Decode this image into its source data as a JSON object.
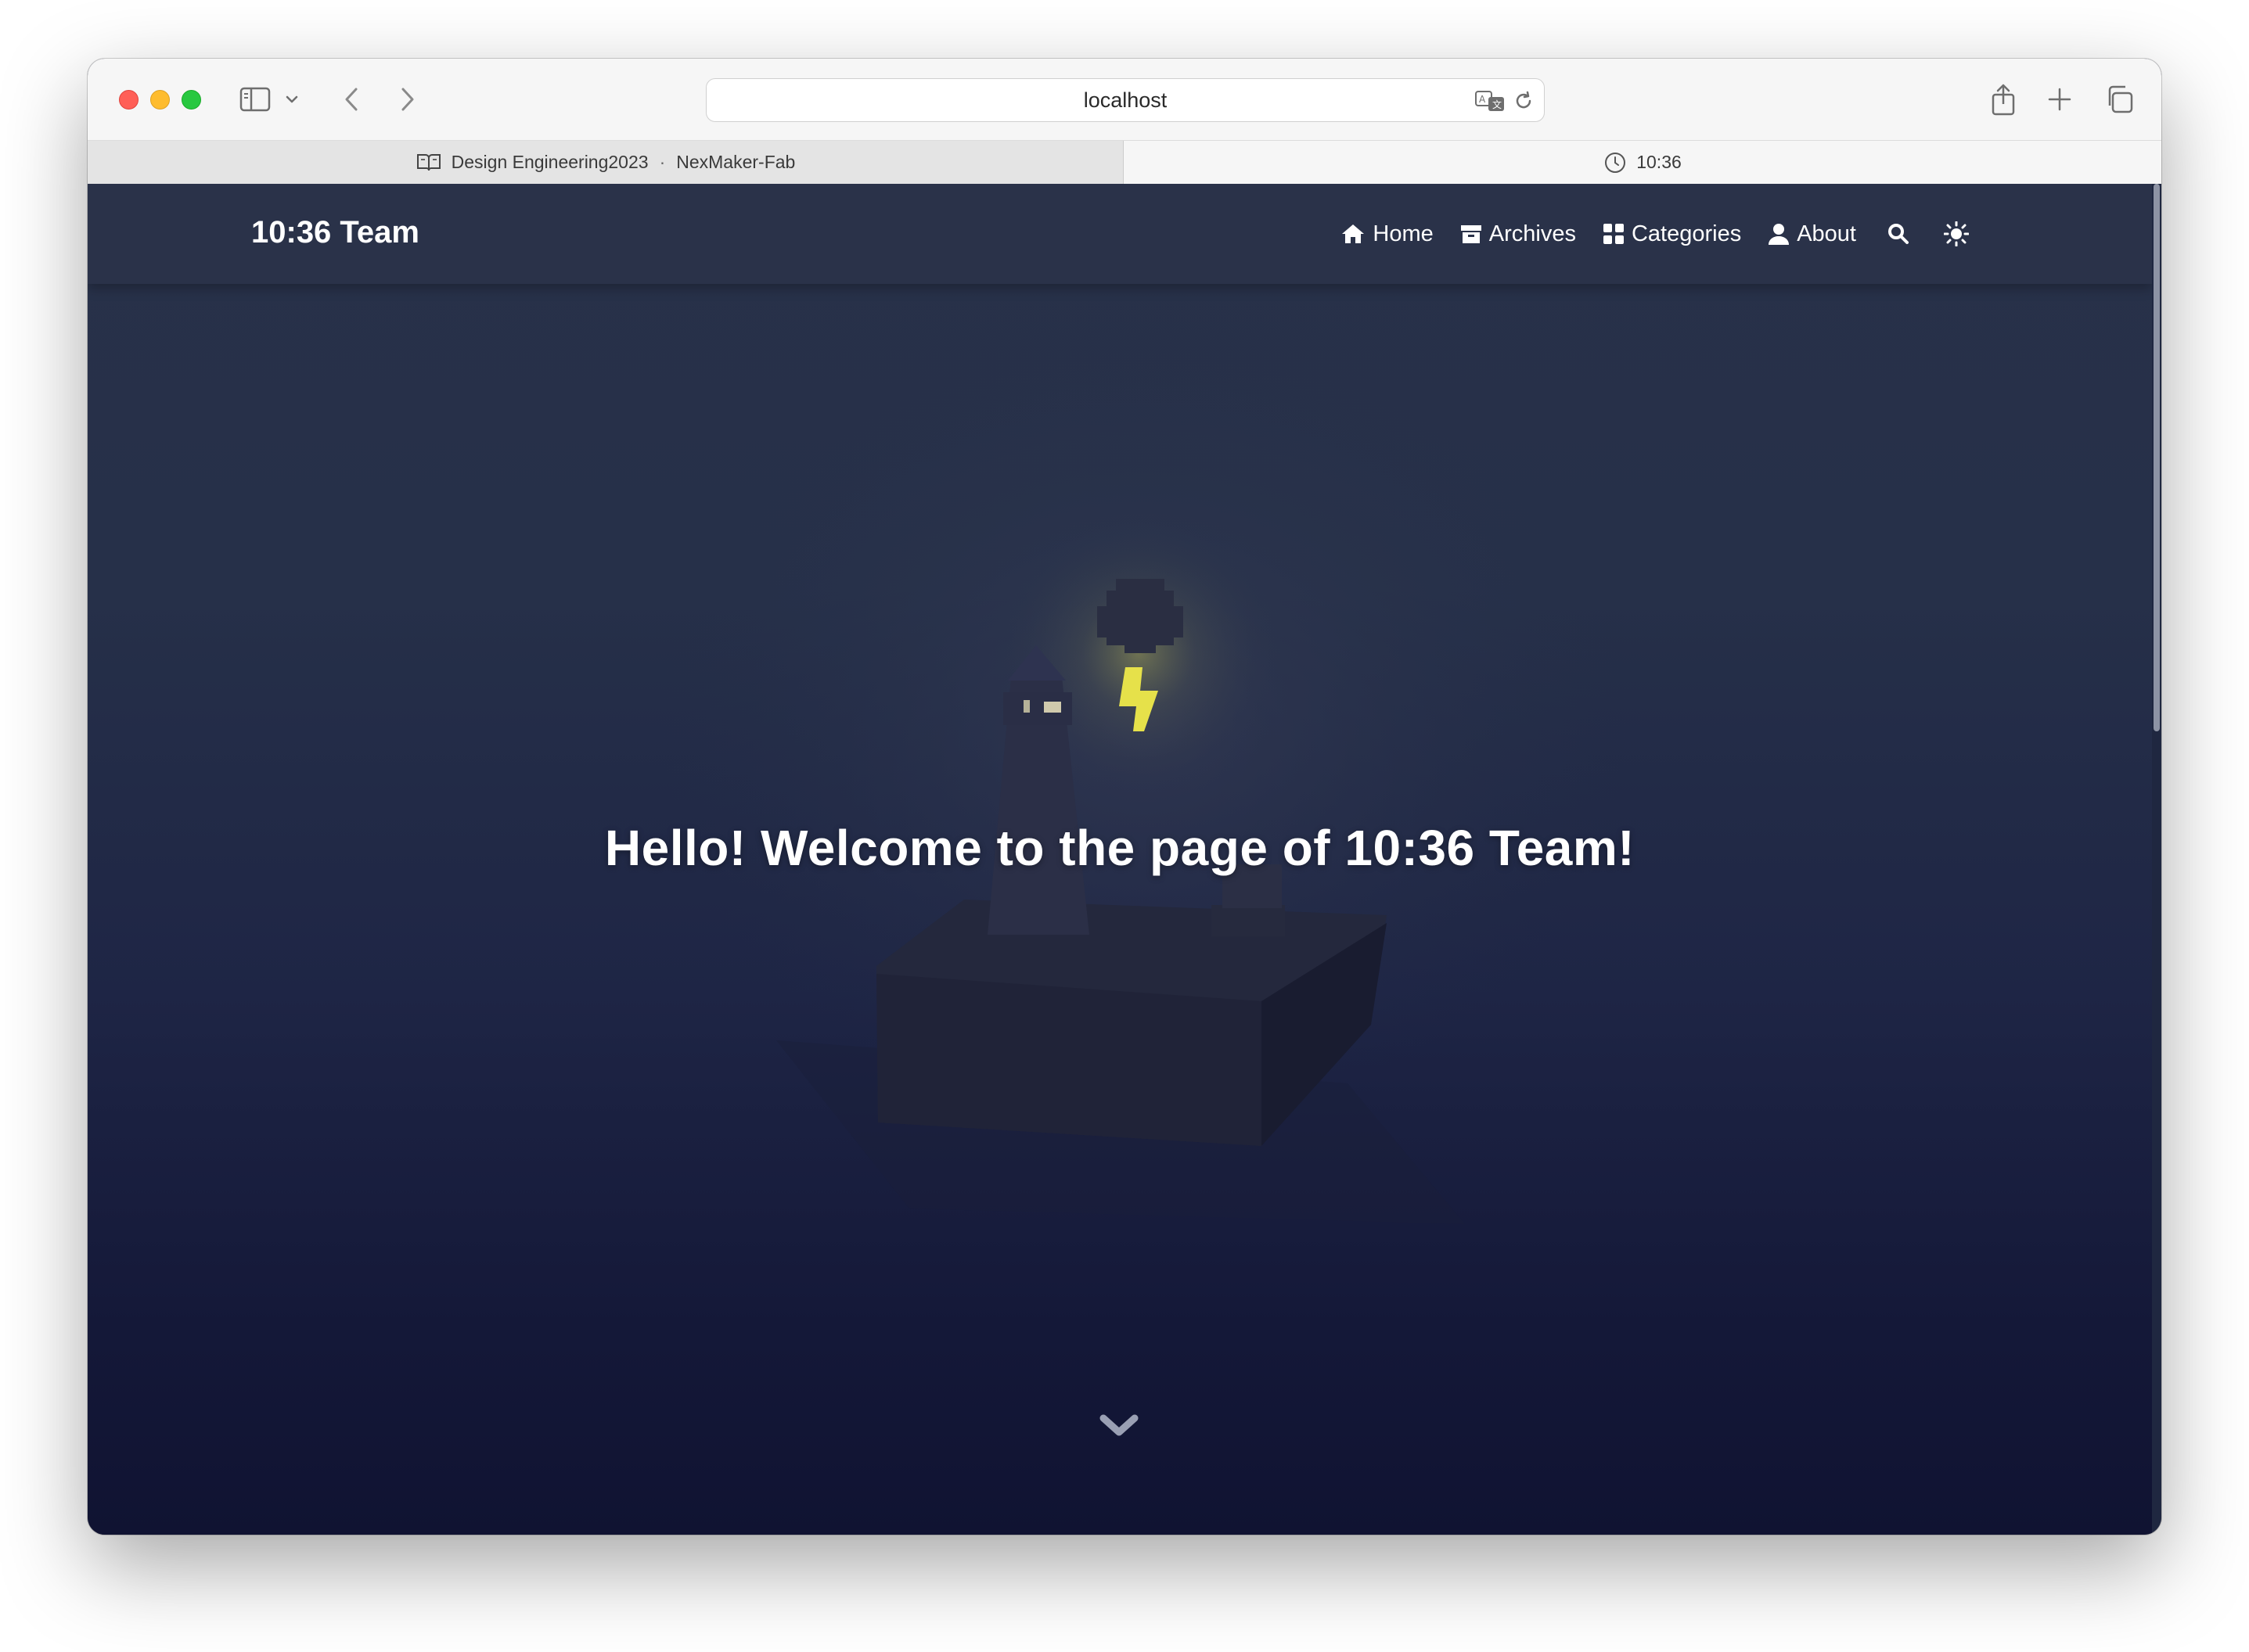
{
  "browser": {
    "url": "localhost",
    "tabs": [
      {
        "title": "Design Engineering2023",
        "subtitle": "NexMaker-Fab",
        "separator": "·"
      },
      {
        "title": "10:36"
      }
    ]
  },
  "site": {
    "brand": "10:36 Team",
    "nav": {
      "home": "Home",
      "archives": "Archives",
      "categories": "Categories",
      "about": "About"
    },
    "hero_title": "Hello! Welcome to the page of 10:36 Team!"
  },
  "colors": {
    "navbar": "#2a3249",
    "hero_top": "#283149",
    "hero_bottom": "#101332",
    "lightning": "#e6e14a"
  }
}
